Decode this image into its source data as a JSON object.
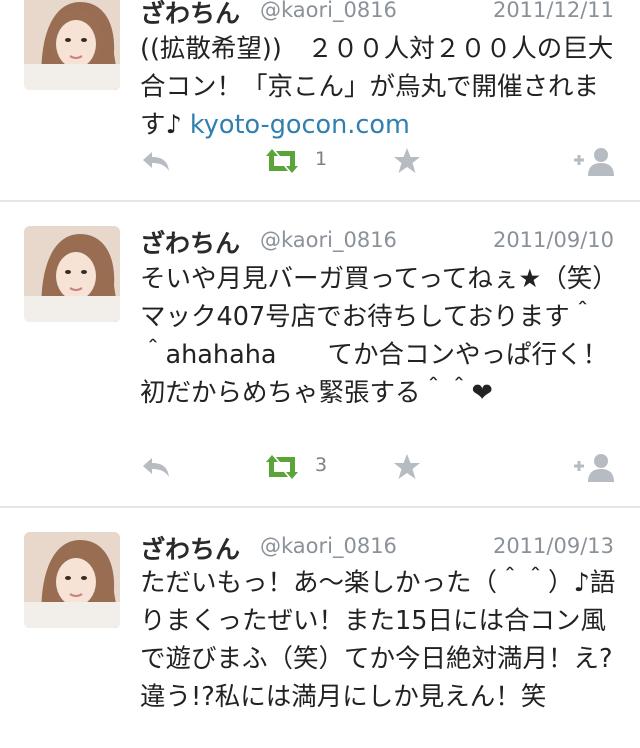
{
  "colors": {
    "retweet": "#5aa43a",
    "muted": "#b6bcc2",
    "link": "#2f7fb0"
  },
  "tweets": [
    {
      "name": "ざわちん",
      "handle": "@kaori_0816",
      "date": "2011/12/11",
      "text": "((拡散希望))　２００人対２００人の巨大合コン！「京こん」が烏丸で開催されます♪ ",
      "link": "kyoto-gocon.com",
      "retweets": "1",
      "icons": [
        "reply-icon",
        "retweet-icon",
        "favorite-icon",
        "follow-icon"
      ]
    },
    {
      "name": "ざわちん",
      "handle": "@kaori_0816",
      "date": "2011/09/10",
      "text": "そいや月見バーガ買ってってねぇ★（笑）マック407号店でお待ちしております＾＾ahahaha　　てか合コンやっぱ行く！初だからめちゃ緊張する＾＾❤",
      "retweets": "3",
      "icons": [
        "reply-icon",
        "retweet-icon",
        "favorite-icon",
        "follow-icon"
      ]
    },
    {
      "name": "ざわちん",
      "handle": "@kaori_0816",
      "date": "2011/09/13",
      "text": "ただいもっ！あ〜楽しかった（＾＾）♪語りまくったぜい！また15日には合コン風で遊びまふ（笑）てか今日絶対満月！え?違う!?私には満月にしか見えん！笑",
      "icons": []
    }
  ]
}
